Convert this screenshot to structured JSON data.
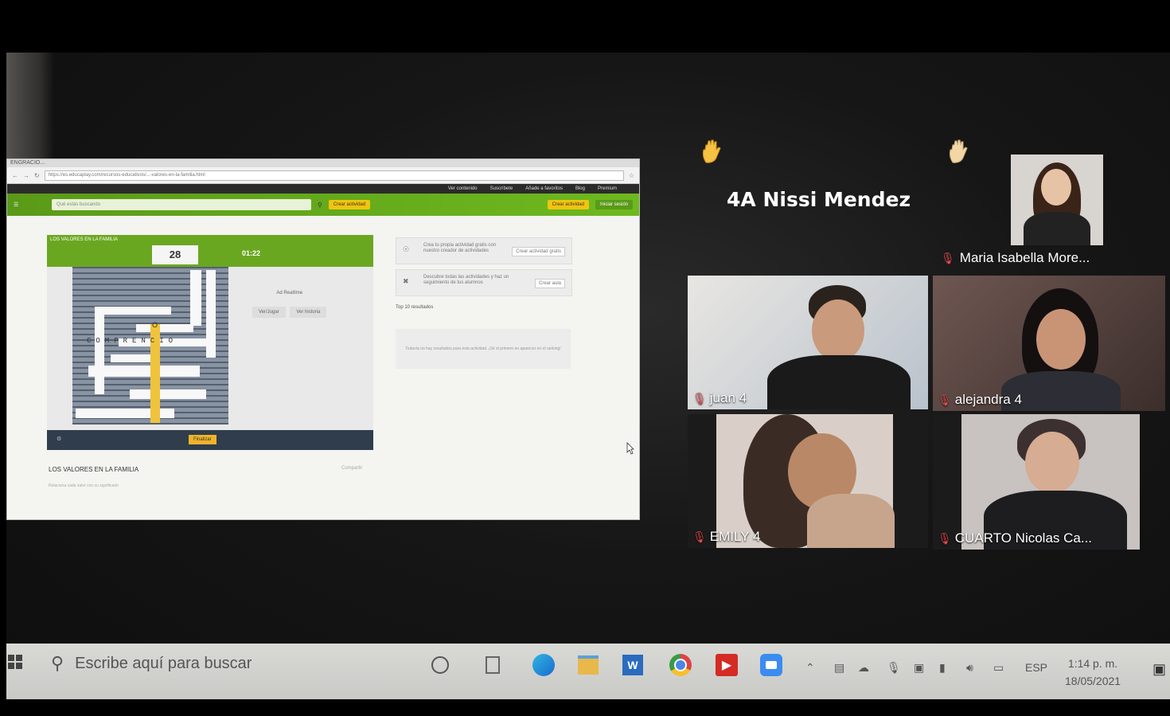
{
  "shared_screen": {
    "browser_tab": "ENGRACIO...",
    "address_bar": "https://es.educaplay.com/recursos-educativos/...-valores-en-la-familia.html",
    "site_top_links": [
      "Ver contenido",
      "Suscríbete",
      "Añade a favoritos",
      "Blog",
      "Premium"
    ],
    "search_placeholder": "Qué estás buscando",
    "nav_button_1": "Crear actividad",
    "nav_button_2": "Crear actividad",
    "nav_button_3": "Iniciar sesión",
    "game_title": "LOS VALORES EN LA FAMILIA",
    "score": "28",
    "timer": "01:22",
    "grid_word": "COMPRENCIO",
    "grid_letter_o": "O",
    "side_panel_label": "Ad Realtime",
    "side_panel_btn_1": "Ver/Jugar",
    "side_panel_btn_2": "Ver historia",
    "footer_button": "Finalizar",
    "card_1_text": "Crea tu propia actividad gratis con nuestro creador de actividades",
    "card_1_button": "Crear actividad gratis",
    "card_2_text": "Descubre todas las actividades y haz un seguimiento de tus alumnos",
    "card_2_button": "Crear aula",
    "results_label": "Top 10 resultados",
    "empty_card_text": "Todavía no hay resultados para esta actividad. ¡Sé el primero en aparecer en el ranking!",
    "below_title": "LOS VALORES EN LA FAMILIA",
    "below_link": "Compartir",
    "below_sub": "Relaciona cada valor con su significado"
  },
  "meeting": {
    "active_speaker": "4A Nissi Mendez",
    "participants": [
      {
        "name": "Maria Isabella More..."
      },
      {
        "name": "juan 4"
      },
      {
        "name": "alejandra 4"
      },
      {
        "name": "EMILY 4"
      },
      {
        "name": "CUARTO Nicolas Ca..."
      }
    ]
  },
  "taskbar": {
    "search_placeholder": "Escribe aquí para buscar",
    "language": "ESP",
    "time": "1:14 p. m.",
    "date": "18/05/2021"
  },
  "colors": {
    "site_green": "#6eb91f",
    "site_yellow": "#f1c40f",
    "mic_muted_red": "#e5484d",
    "hand_yellow": "#f5c242"
  }
}
